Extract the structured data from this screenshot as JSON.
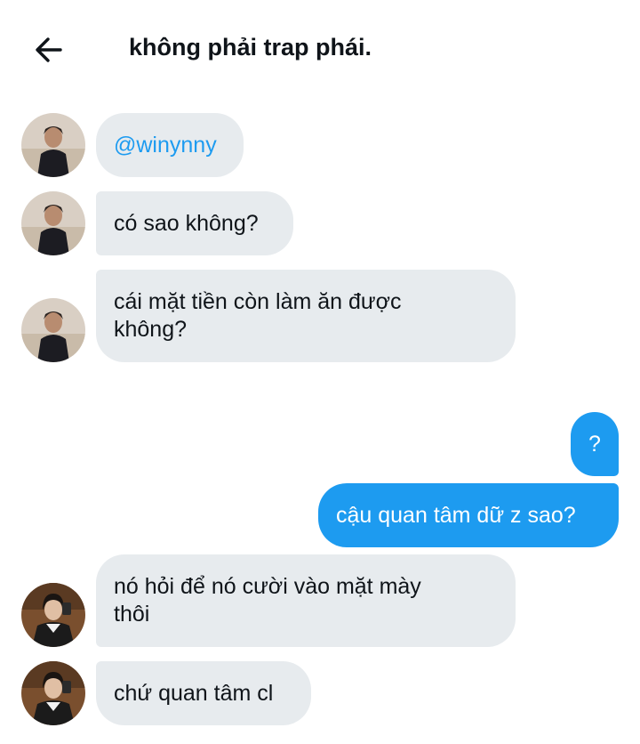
{
  "header": {
    "back_icon": "arrow-left-icon",
    "title": "không phải trap phái."
  },
  "messages": [
    {
      "side": "left",
      "text": "@winynny",
      "is_mention": true,
      "avatar": "avatar-user-1"
    },
    {
      "side": "left",
      "text": "có sao không?",
      "avatar": "avatar-user-1"
    },
    {
      "side": "left",
      "text": "cái mặt tiền còn làm ăn được không?",
      "avatar": "avatar-user-1"
    },
    {
      "side": "right",
      "text": "?"
    },
    {
      "side": "right",
      "text": "cậu quan tâm dữ z sao?"
    },
    {
      "side": "left",
      "text": "nó hỏi để nó cười vào mặt mày thôi",
      "avatar": "avatar-user-2"
    },
    {
      "side": "left",
      "text": "chứ quan tâm cl",
      "avatar": "avatar-user-2"
    }
  ],
  "colors": {
    "accent": "#1d9bf0",
    "bubble_received": "#e7ebee",
    "text": "#0f1419"
  }
}
